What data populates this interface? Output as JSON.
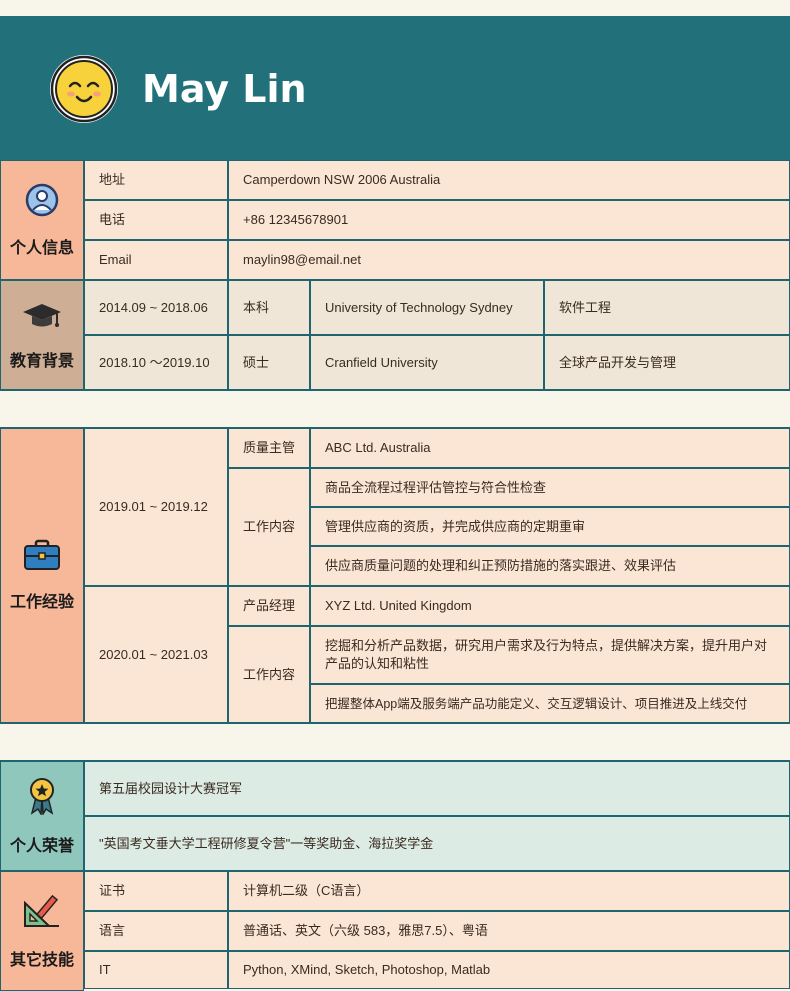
{
  "profile": {
    "name": "May Lin",
    "avatar_icon": "smiley-face-icon"
  },
  "personal": {
    "category": "个人信息",
    "icon": "user-icon",
    "rows": [
      {
        "label": "地址",
        "value": "Camperdown NSW 2006 Australia"
      },
      {
        "label": "电话",
        "value": "+86 12345678901"
      },
      {
        "label": "Email",
        "value": "maylin98@email.net"
      }
    ]
  },
  "education": {
    "category": "教育背景",
    "icon": "graduation-cap-icon",
    "rows": [
      {
        "period": "2014.09 ~ 2018.06",
        "degree": "本科",
        "school": "University of Technology Sydney",
        "major": "软件工程"
      },
      {
        "period": "2018.10 ～2019.10",
        "degree": "硕士",
        "school": "Cranfield University",
        "major": "全球产品开发与管理"
      }
    ]
  },
  "work": {
    "category": "工作经验",
    "icon": "briefcase-icon",
    "jobs": [
      {
        "period": "2019.01 ~ 2019.12",
        "title": "质量主管",
        "company": "ABC Ltd. Australia",
        "content_label": "工作内容",
        "duties": [
          "商品全流程过程评估管控与符合性检查",
          "管理供应商的资质，并完成供应商的定期重审",
          "供应商质量问题的处理和纠正预防措施的落实跟进、效果评估"
        ]
      },
      {
        "period": "2020.01 ~ 2021.03",
        "title": "产品经理",
        "company": "XYZ Ltd. United Kingdom",
        "content_label": "工作内容",
        "duties": [
          "挖掘和分析产品数据，研究用户需求及行为特点，提供解决方案，提升用户对产品的认知和粘性",
          "把握整体App端及服务端产品功能定义、交互逻辑设计、项目推进及上线交付"
        ]
      }
    ]
  },
  "honors": {
    "category": "个人荣誉",
    "icon": "medal-icon",
    "items": [
      "第五届校园设计大赛冠军",
      "\"英国考文垂大学工程研修夏令营\"一等奖助金、海拉奖学金"
    ]
  },
  "skills": {
    "category": "其它技能",
    "icon": "drawing-tools-icon",
    "rows": [
      {
        "label": "证书",
        "value": "计算机二级（C语言）"
      },
      {
        "label": "语言",
        "value": "普通话、英文（六级 583，雅思7.5）、粤语"
      },
      {
        "label": "IT",
        "value": "Python, XMind, Sketch, Photoshop, Matlab"
      }
    ]
  },
  "colors": {
    "header": "#22707a",
    "border": "#1f6570",
    "peach": "#fbe6d5",
    "peach_category": "#f6b898",
    "beige": "#efe6d8",
    "beige_category": "#cfae96",
    "mint": "#dcebe3",
    "mint_category": "#8fc7bd"
  }
}
